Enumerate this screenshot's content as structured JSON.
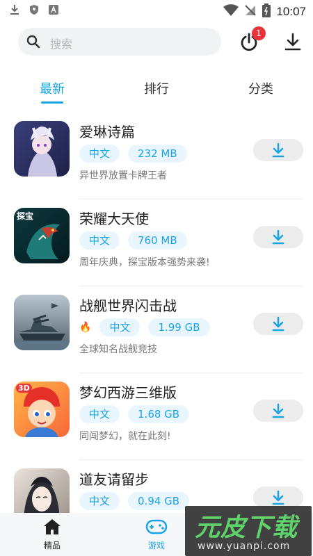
{
  "status_bar": {
    "time": "10:07",
    "icons": [
      "download-icon",
      "shield-icon",
      "a-icon",
      "wifi-icon",
      "no-sim-icon",
      "battery-icon"
    ]
  },
  "search": {
    "placeholder": "搜索"
  },
  "header": {
    "notification_count": "1"
  },
  "tabs": [
    {
      "label": "最新",
      "active": true
    },
    {
      "label": "排行",
      "active": false
    },
    {
      "label": "分类",
      "active": false
    }
  ],
  "apps": [
    {
      "name": "爱琳诗篇",
      "tags": [
        "中文",
        "232 MB"
      ],
      "hot": false,
      "desc": "异世界放置卡牌王者"
    },
    {
      "name": "荣耀大天使",
      "tags": [
        "中文",
        "760 MB"
      ],
      "hot": false,
      "desc": "周年庆典，探宝版本强势来袭!",
      "icon_badge": "探宝"
    },
    {
      "name": "战舰世界闪击战",
      "tags": [
        "中文",
        "1.99 GB"
      ],
      "hot": true,
      "desc": "全球知名战舰竞技"
    },
    {
      "name": "梦幻西游三维版",
      "tags": [
        "中文",
        "1.68 GB"
      ],
      "hot": false,
      "desc": "同闯梦幻，就在此刻!",
      "icon_badge": "3D"
    },
    {
      "name": "道友请留步",
      "tags": [
        "中文",
        "0.94 GB"
      ],
      "hot": false,
      "desc": ""
    }
  ],
  "bottom_nav": [
    {
      "label": "精品",
      "icon": "home-icon",
      "active": false
    },
    {
      "label": "游戏",
      "icon": "gamepad-icon",
      "active": true
    }
  ],
  "watermark": {
    "logo": "元皮下载",
    "url": "www.yuanpi.com"
  },
  "colors": {
    "accent": "#19a4e6",
    "tag_bg": "#eaf6fd",
    "badge": "#e8333a"
  }
}
